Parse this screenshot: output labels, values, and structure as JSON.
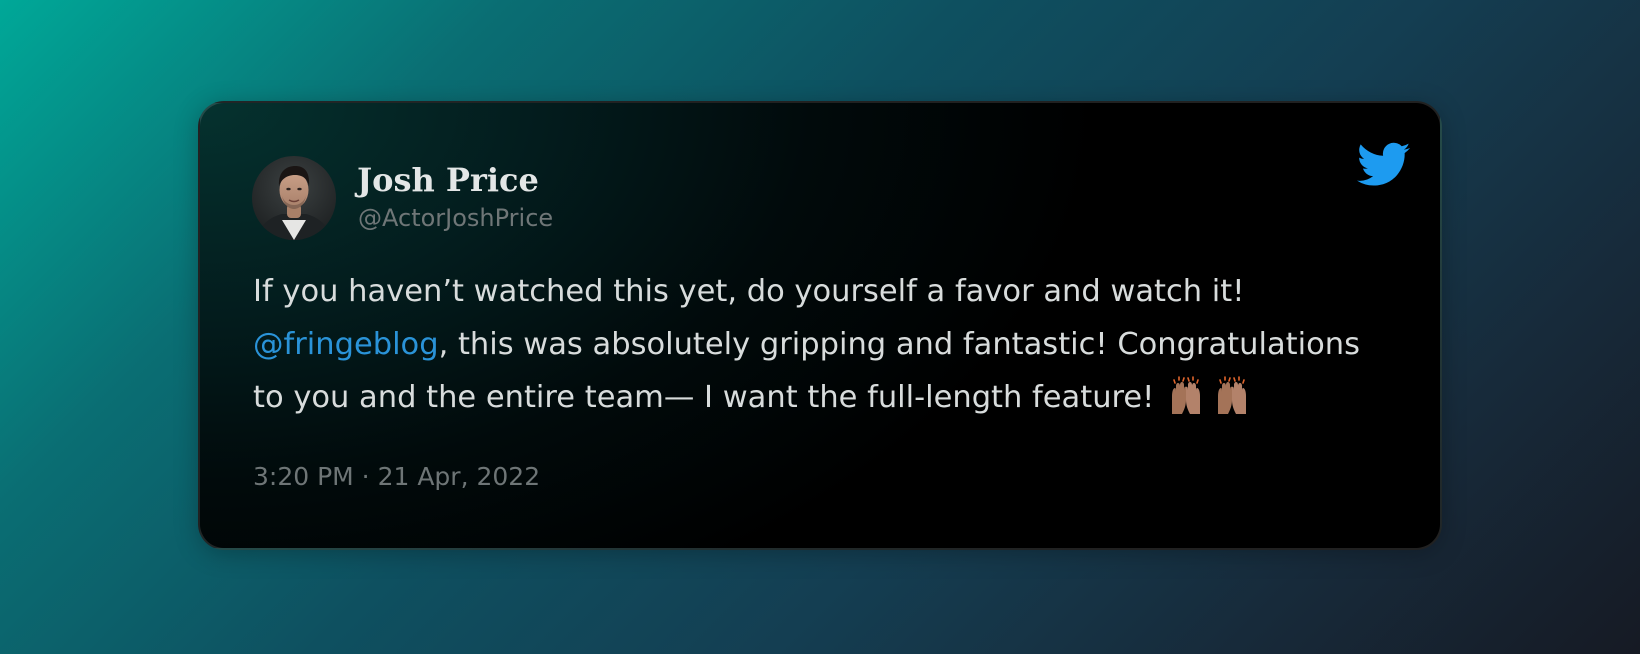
{
  "tweet": {
    "author": {
      "name": "Josh Price",
      "handle": "@ActorJoshPrice"
    },
    "text": {
      "line1": "If you haven’t watched this yet, do yourself a favor and watch it!",
      "mention": "@fringeblog",
      "line2_rest": ", this was absolutely gripping and fantastic! Congratulations",
      "line3": "to you and the entire team— I want the full-length feature!",
      "emojis": [
        "raising-hands-medium-skin-emoji",
        "raising-hands-medium-skin-emoji"
      ]
    },
    "timestamp": "3:20 PM · 21 Apr, 2022"
  },
  "colors": {
    "mention": "#2a93d8",
    "twitter_blue": "#1d9bf0",
    "text": "#d8dcdc",
    "muted": "#6e7576"
  },
  "icons": {
    "brand": "twitter-bird-icon",
    "avatar": "profile-photo"
  }
}
